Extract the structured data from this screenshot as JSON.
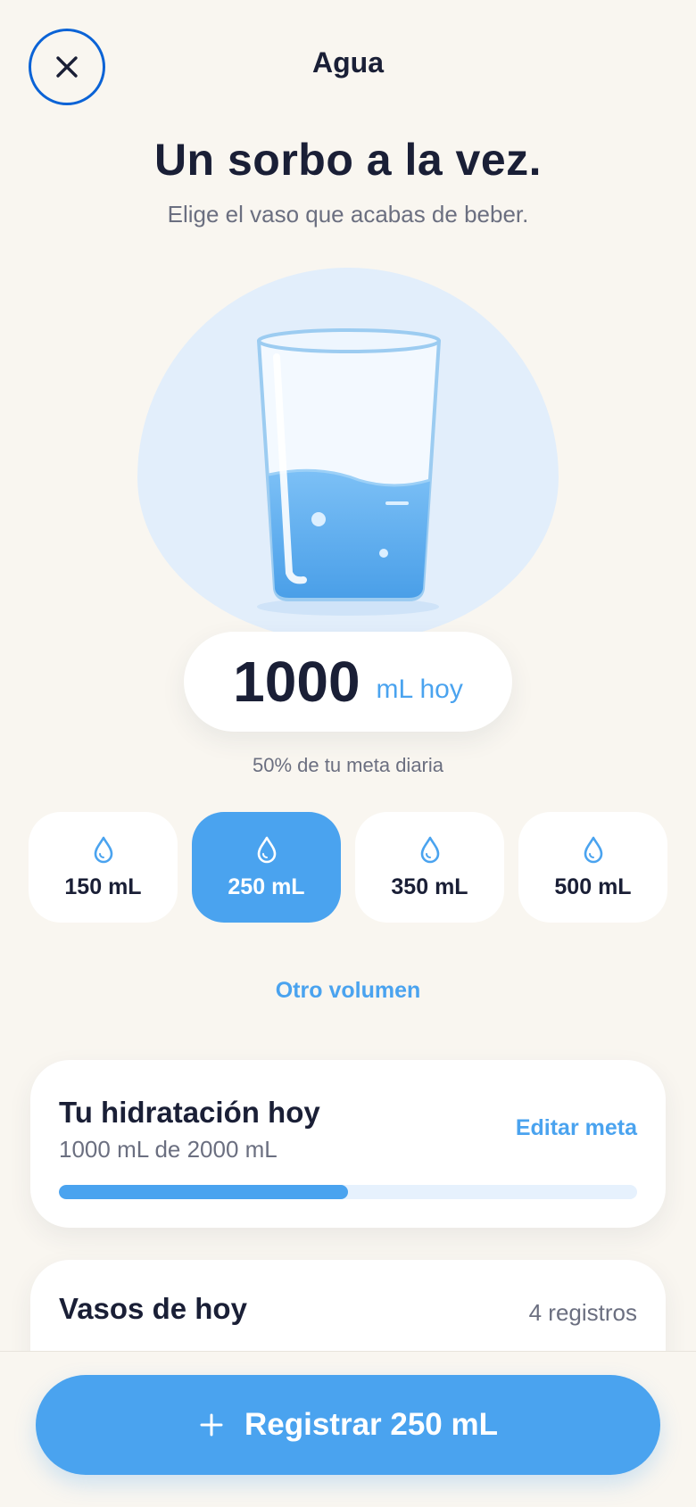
{
  "header": {
    "title": "Agua"
  },
  "hero": {
    "headline": "Un sorbo a la vez.",
    "subline": "Elige el vaso que acabas de beber."
  },
  "today": {
    "amount": "1000",
    "unit": "mL hoy",
    "goal_percent_text": "50% de tu meta diaria"
  },
  "sizes": [
    {
      "label": "150 mL",
      "selected": false
    },
    {
      "label": "250 mL",
      "selected": true
    },
    {
      "label": "350 mL",
      "selected": false
    },
    {
      "label": "500 mL",
      "selected": false
    }
  ],
  "other_volume_label": "Otro volumen",
  "hydration_card": {
    "title": "Tu hidratación hoy",
    "subtitle": "1000 mL de 2000 mL",
    "edit_label": "Editar meta",
    "progress_fraction": 0.5
  },
  "glasses_card": {
    "title": "Vasos de hoy",
    "count_label": "4 registros"
  },
  "register_button": {
    "label": "Registrar 250 mL"
  },
  "colors": {
    "accent": "#4aa3ef",
    "close_ring": "#0b63d6",
    "background": "#f9f6f0",
    "text": "#1a1f36"
  },
  "icons": {
    "close": "close-icon",
    "drop": "water-drop-icon",
    "plus": "plus-icon",
    "glass": "water-glass-illustration"
  }
}
